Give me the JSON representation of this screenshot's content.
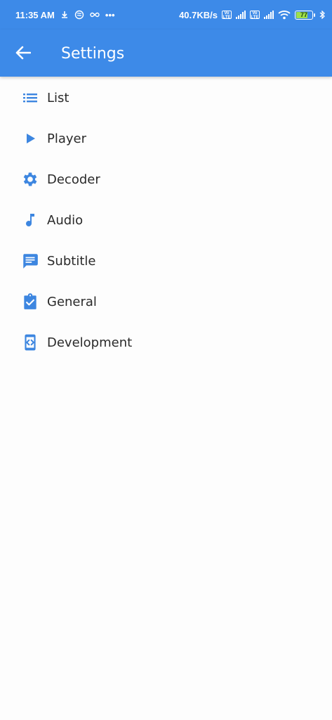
{
  "status_bar": {
    "time": "11:35 AM",
    "more_indicator": "•••",
    "network_speed": "40.7KB/s",
    "lte_badge": "Vo LTE",
    "battery_level": "77",
    "battery_fraction": 0.77,
    "icons": [
      "download-icon",
      "rotation-icon",
      "infinity-icon",
      "signal-icon",
      "wifi-icon",
      "battery-icon",
      "bluetooth-icon"
    ]
  },
  "app_bar": {
    "title": "Settings",
    "back_icon": "arrow-back-icon"
  },
  "colors": {
    "primary": "#3d8ae8",
    "icon": "#3d86e0",
    "text": "#2a2a2a",
    "background": "#fdfdfd"
  },
  "settings": {
    "items": [
      {
        "label": "List",
        "icon": "list-icon"
      },
      {
        "label": "Player",
        "icon": "play-icon"
      },
      {
        "label": "Decoder",
        "icon": "gear-icon"
      },
      {
        "label": "Audio",
        "icon": "music-note-icon"
      },
      {
        "label": "Subtitle",
        "icon": "subtitle-chat-icon"
      },
      {
        "label": "General",
        "icon": "clipboard-check-icon"
      },
      {
        "label": "Development",
        "icon": "developer-mode-icon"
      }
    ]
  }
}
